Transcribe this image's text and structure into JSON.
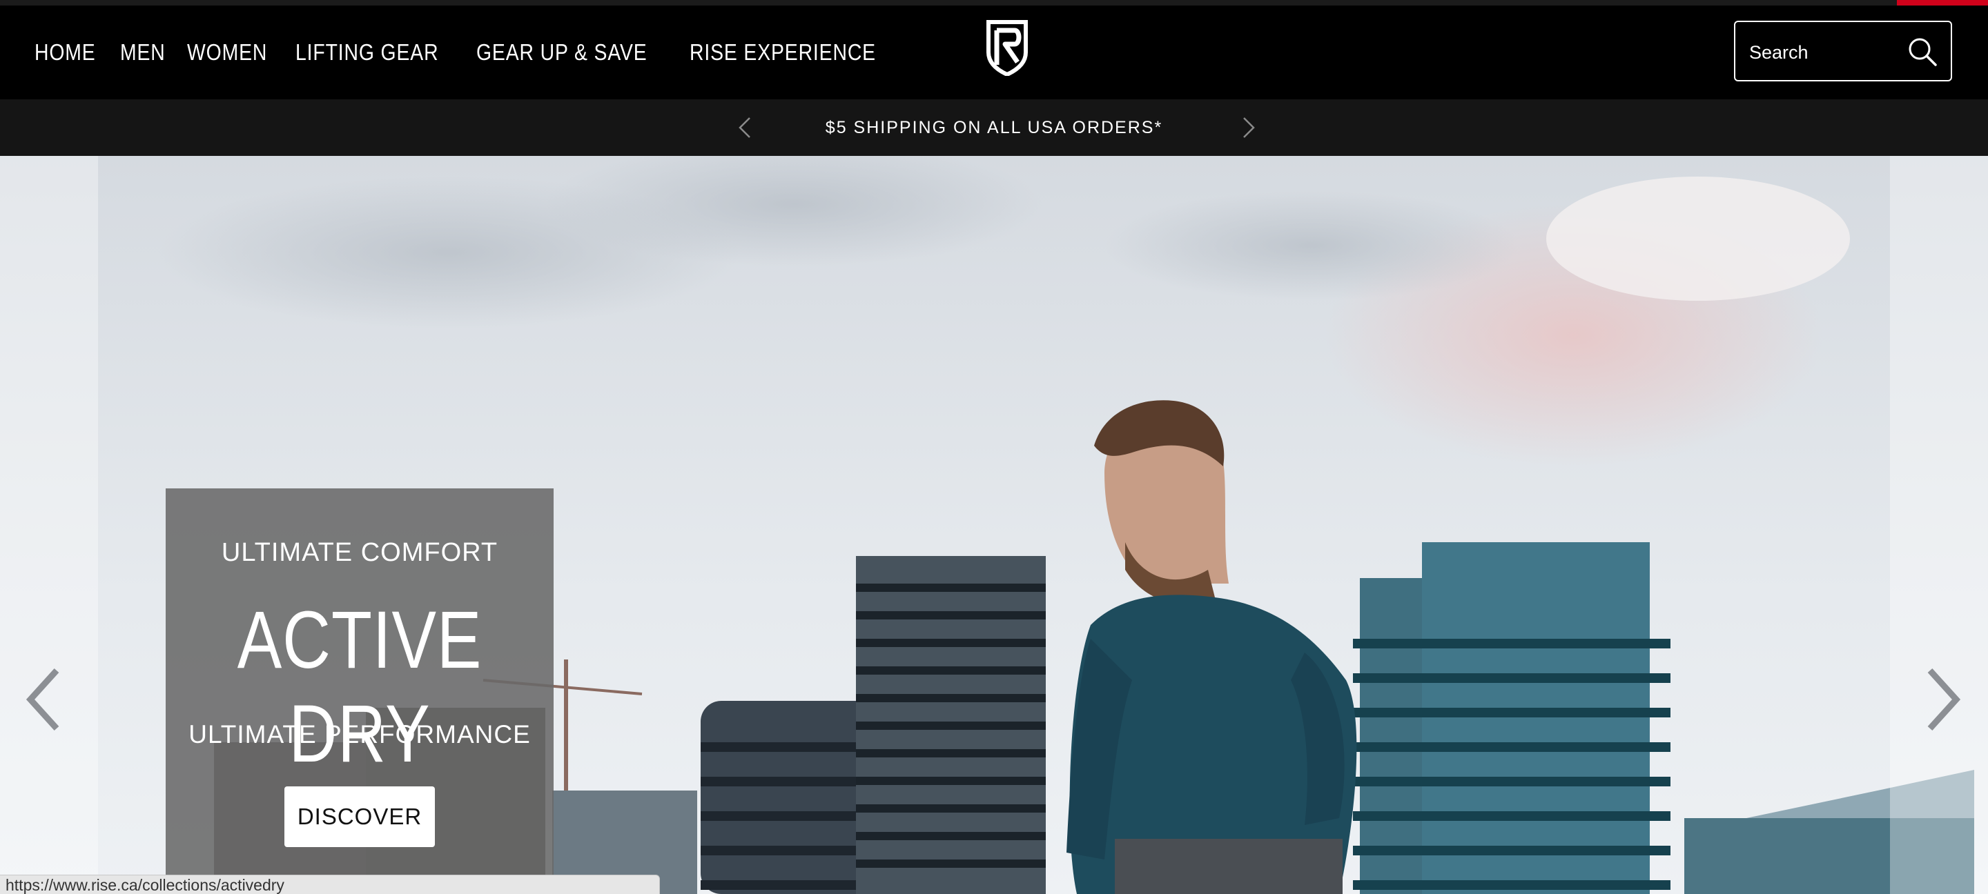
{
  "colors": {
    "brand_red": "#d0021b",
    "header_bg": "#000000",
    "announce_bg": "#151515",
    "promo_bg": "#696969"
  },
  "nav": {
    "items": [
      {
        "label": "HOME"
      },
      {
        "label": "MEN"
      },
      {
        "label": "WOMEN"
      },
      {
        "label": "LIFTING GEAR"
      },
      {
        "label": "GEAR UP & SAVE"
      },
      {
        "label": "RISE EXPERIENCE"
      }
    ]
  },
  "logo": {
    "icon": "rise-r-logo"
  },
  "search": {
    "placeholder": "Search",
    "icon": "search-icon"
  },
  "announcement": {
    "text": "$5 SHIPPING ON ALL USA ORDERS*",
    "prev_icon": "chevron-left-icon",
    "next_icon": "chevron-right-icon"
  },
  "hero": {
    "eyebrow": "ULTIMATE COMFORT",
    "headline": "ACTIVE DRY",
    "subline": "ULTIMATE PERFORMANCE",
    "cta_label": "DISCOVER"
  },
  "status_bar": {
    "url": "https://www.rise.ca/collections/activedry"
  }
}
